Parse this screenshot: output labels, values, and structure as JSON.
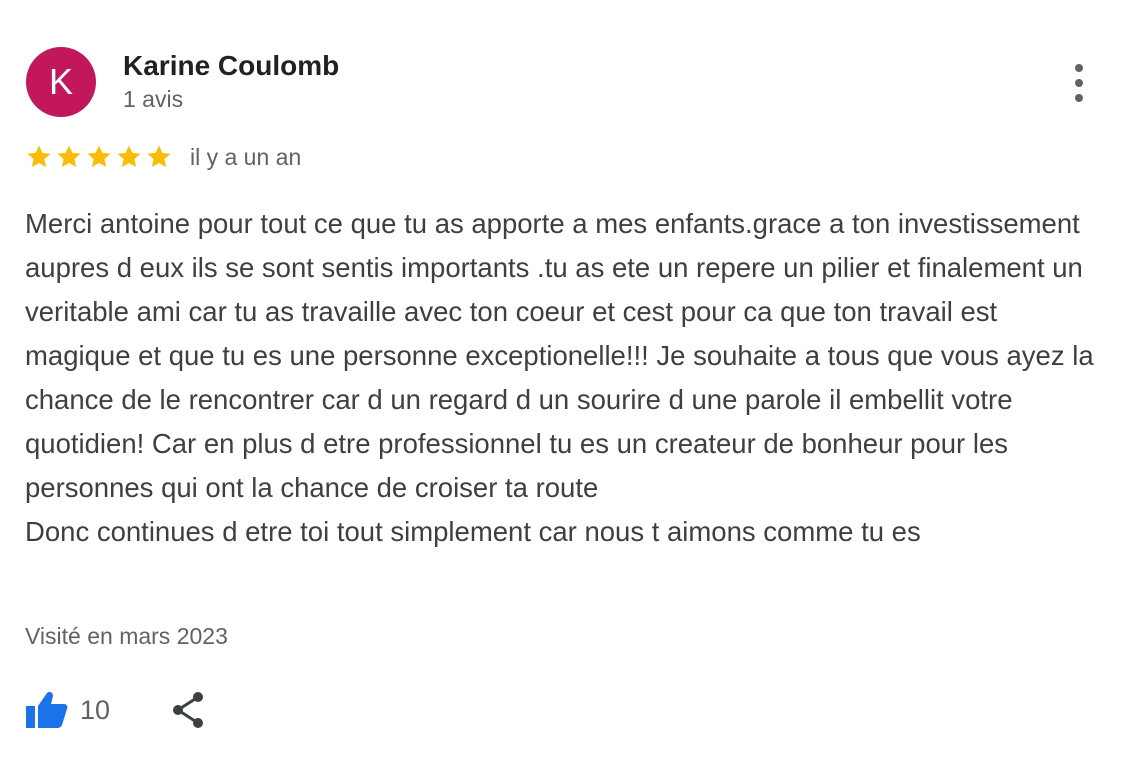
{
  "author": {
    "initial": "K",
    "name": "Karine Coulomb",
    "meta": "1 avis",
    "avatar_color": "#c2185b"
  },
  "menu": {
    "icon": "more-vert-icon"
  },
  "rating": {
    "stars": 5,
    "max": 5,
    "star_color": "#fbbc04",
    "date": "il y a un an"
  },
  "review": {
    "paragraphs": [
      "Merci antoine pour tout ce que tu as apporte a mes enfants.grace a ton investissement aupres d eux ils se sont sentis importants .tu as ete un repere un pilier et finalement un veritable ami car tu as travaille avec ton coeur et cest pour ca que ton travail est magique et que tu es une personne exceptionelle!!! Je souhaite a tous que vous ayez la chance de le rencontrer car d un regard d un sourire d une parole il embellit votre quotidien! Car en plus d etre professionnel tu es un createur de bonheur pour les personnes qui ont la chance de croiser ta route",
      "Donc continues d etre toi tout simplement car nous t aimons comme tu es"
    ]
  },
  "visit": {
    "text": "Visité en mars 2023"
  },
  "actions": {
    "like_icon": "thumb-up-icon",
    "like_count": "10",
    "like_color": "#1a73e8",
    "share_icon": "share-icon"
  }
}
